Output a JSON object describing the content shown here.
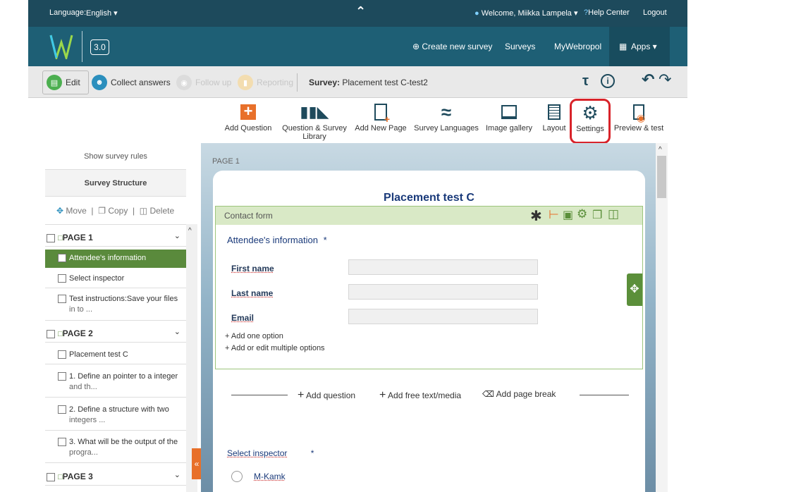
{
  "topbar": {
    "language_label": "Language:",
    "language_value": "English ▾",
    "collapse_glyph": "⌃",
    "welcome": "Welcome, Miikka Lampela ▾",
    "help": "Help Center",
    "logout": "Logout"
  },
  "navbar": {
    "version": "3.0",
    "create": "⊕ Create new survey",
    "surveys": "Surveys",
    "mywebropol": "MyWebropol",
    "apps": "Apps ▾"
  },
  "toolbar": {
    "edit": "Edit",
    "collect": "Collect answers",
    "followup": "Follow up",
    "reporting": "Reporting",
    "survey_label": "Survey:",
    "survey_name": "Placement test C-test2"
  },
  "ribbon": {
    "add_question": "Add Question",
    "library_line1": "Question & Survey",
    "library_line2": "Library",
    "add_page": "Add New Page",
    "languages": "Survey Languages",
    "gallery": "Image gallery",
    "layout": "Layout",
    "settings": "Settings",
    "preview": "Preview & test"
  },
  "sidebar": {
    "show_rules": "Show survey rules",
    "structure": "Survey Structure",
    "move": "Move",
    "copy": "Copy",
    "delete": "Delete",
    "items": [
      {
        "kind": "page",
        "label": "PAGE 1"
      },
      {
        "kind": "item",
        "label": "Attendee's information",
        "selected": true
      },
      {
        "kind": "item",
        "label": "Select inspector"
      },
      {
        "kind": "item",
        "label": "Test instructions:Save your files",
        "label2": "in to ..."
      },
      {
        "kind": "page",
        "label": "PAGE 2"
      },
      {
        "kind": "item",
        "label": "Placement test C"
      },
      {
        "kind": "item",
        "label": "1. Define an pointer to a integer",
        "label2": "and th..."
      },
      {
        "kind": "item",
        "label": "2. Define a structure with two",
        "label2": "integers ..."
      },
      {
        "kind": "item",
        "label": "3. What will be the output of the",
        "label2": "progra..."
      },
      {
        "kind": "page",
        "label": "PAGE 3"
      }
    ]
  },
  "main": {
    "page_label": "PAGE  1",
    "title": "Placement test C",
    "section": "Contact form",
    "question": "Attendee's information",
    "required": "*",
    "fields": [
      "First name",
      "Last name",
      "Email"
    ],
    "add_one": "+ Add one option",
    "add_multi": "+ Add or edit multiple options",
    "add_question": "Add question",
    "add_free": "Add free text/media",
    "add_break": "Add page break",
    "select_inspector": "Select inspector",
    "option1": "M-Kamk"
  },
  "colors": {
    "top": "#1d4a5c",
    "nav": "#1e5f75",
    "green": "#5b8f3a",
    "orange": "#e8702a",
    "highlight_red": "#d8232a",
    "selected_bg": "#5a8a3c"
  }
}
